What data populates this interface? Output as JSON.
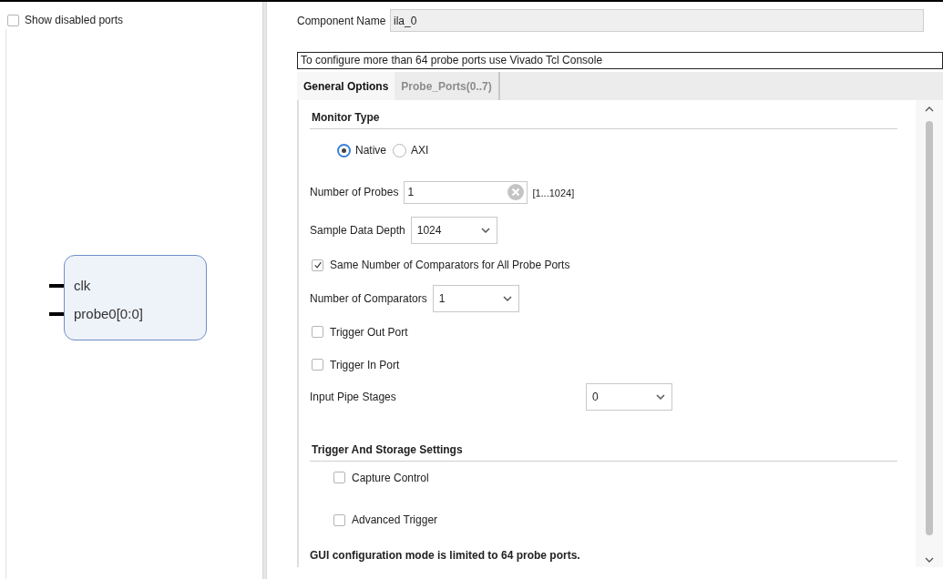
{
  "left_panel": {
    "show_disabled_ports": {
      "label": "Show disabled ports",
      "checked": false
    },
    "symbol": {
      "ports": [
        {
          "name": "clk"
        },
        {
          "name": "probe0[0:0]"
        }
      ]
    }
  },
  "component_name": {
    "label": "Component Name",
    "value": "ila_0"
  },
  "notice": "To configure more than 64 probe ports use Vivado Tcl Console",
  "tabs": [
    {
      "label": "General Options",
      "selected": true
    },
    {
      "label": "Probe_Ports(0..7)",
      "selected": false
    }
  ],
  "form": [
    {
      "kind": "section",
      "label": "Monitor Type"
    },
    {
      "kind": "radio_group",
      "options": [
        {
          "label": "Native",
          "selected": true
        },
        {
          "label": "AXI",
          "selected": false
        }
      ]
    },
    {
      "kind": "text_field",
      "label": "Number of Probes",
      "value": "1",
      "range": "[1...1024]"
    },
    {
      "kind": "dropdown",
      "label": "Sample Data Depth",
      "value": "1024"
    },
    {
      "kind": "checkbox",
      "label": "Same Number of Comparators for All Probe Ports",
      "checked": true
    },
    {
      "kind": "dropdown",
      "label": "Number of Comparators",
      "value": "1"
    },
    {
      "kind": "checkbox",
      "label": "Trigger Out Port",
      "checked": false
    },
    {
      "kind": "checkbox",
      "label": "Trigger In Port",
      "checked": false
    },
    {
      "kind": "dropdown",
      "label": "Input Pipe Stages",
      "value": "0"
    },
    {
      "kind": "section",
      "label": "Trigger And Storage Settings"
    },
    {
      "kind": "checkbox",
      "label": "Capture Control",
      "checked": false
    },
    {
      "kind": "checkbox",
      "label": "Advanced Trigger",
      "checked": false
    }
  ],
  "footer_note": "GUI configuration mode is limited to 64 probe ports."
}
